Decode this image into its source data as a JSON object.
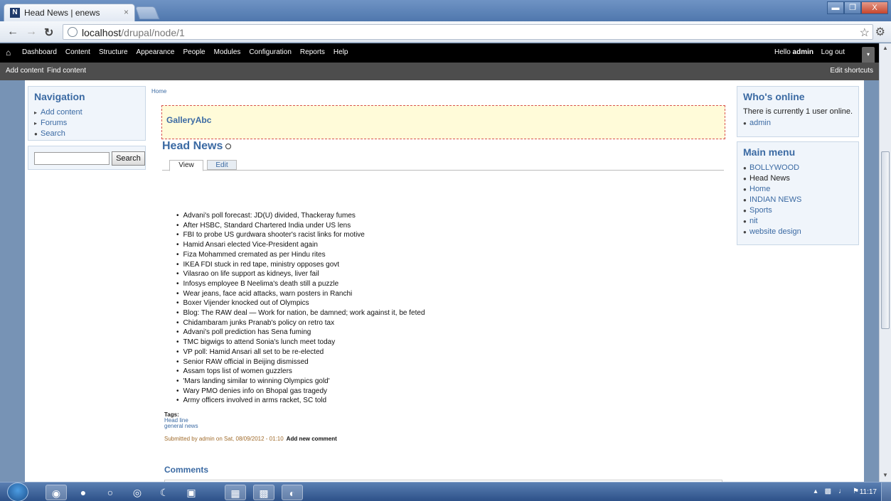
{
  "browser": {
    "tab_title": "Head News | enews",
    "favicon_letter": "N",
    "tab_close": "×",
    "url_host": "localhost",
    "url_path": "/drupal/node/1",
    "window_controls": [
      "▬",
      "❐",
      "X"
    ]
  },
  "toolbar": {
    "home_icon": "home-icon",
    "menu": [
      "Dashboard",
      "Content",
      "Structure",
      "Appearance",
      "People",
      "Modules",
      "Configuration",
      "Reports",
      "Help"
    ],
    "hello": "Hello",
    "user": "admin",
    "logout": "Log out",
    "toggle": "▾"
  },
  "shortcuts": {
    "add_content": "Add content",
    "find_content": "Find content",
    "edit_shortcuts": "Edit shortcuts"
  },
  "navigation": {
    "title": "Navigation",
    "items": [
      "Add content",
      "Forums",
      "Search"
    ]
  },
  "search": {
    "value": "",
    "button": "Search"
  },
  "breadcrumb": "Home",
  "gallery": "GalleryAbc",
  "node": {
    "title": "Head News",
    "tabs": {
      "view": "View",
      "edit": "Edit"
    },
    "headlines": [
      "Advani's poll forecast: JD(U) divided, Thackeray fumes",
      "After HSBC, Standard Chartered India under US lens",
      "FBI to probe US gurdwara shooter's racist links for motive",
      "Hamid Ansari elected Vice-President again",
      "Fiza Mohammed cremated as per Hindu rites",
      "IKEA FDI stuck in red tape, ministry opposes govt",
      "Vilasrao on life support as kidneys, liver fail",
      "Infosys employee B Neelima's death still a puzzle",
      "Wear jeans, face acid attacks, warn posters in Ranchi",
      "Boxer Vijender knocked out of Olympics",
      "Blog: The RAW deal — Work for nation, be damned; work against it, be feted",
      "Chidambaram junks Pranab's policy on retro tax",
      "Advani's poll prediction has Sena fuming",
      "TMC bigwigs to attend Sonia's lunch meet today",
      "VP poll: Hamid Ansari all set to be re-elected",
      "Senior RAW official in Beijing dismissed",
      "Assam tops list of women guzzlers",
      "'Mars landing similar to winning Olympics gold'",
      "Wary PMO denies info on Bhopal gas tragedy",
      "Army officers involved in arms racket, SC told"
    ],
    "tags_label": "Tags:",
    "tags": [
      "Head line",
      "general news"
    ],
    "submitted": "Submitted by admin on Sat, 08/09/2012 - 01:10",
    "add_comment": "Add new comment",
    "comments_title": "Comments"
  },
  "whos_online": {
    "title": "Who's online",
    "text": "There is currently 1 user online.",
    "users": [
      "admin"
    ]
  },
  "main_menu": {
    "title": "Main menu",
    "items": [
      "BOLLYWOOD",
      "Head News",
      "Home",
      "INDIAN NEWS",
      "Sports",
      "nit",
      "website design"
    ]
  },
  "taskbar": {
    "clock": "11:17"
  }
}
